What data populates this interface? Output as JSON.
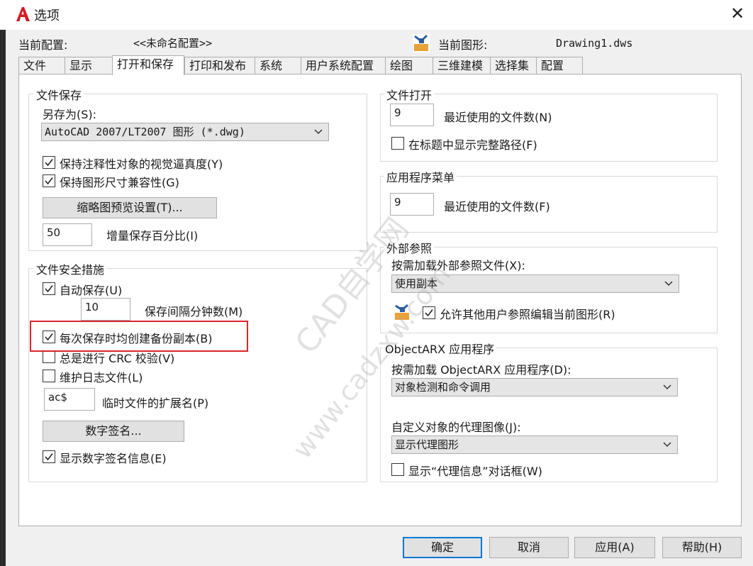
{
  "window": {
    "title": "选项",
    "close_glyph": "✕"
  },
  "header": {
    "profile_label": "当前配置:",
    "profile_value": "<<未命名配置>>",
    "drawing_label": "当前图形:",
    "drawing_value": "Drawing1.dws"
  },
  "tabs": [
    {
      "label": "文件"
    },
    {
      "label": "显示"
    },
    {
      "label": "打开和保存",
      "active": true
    },
    {
      "label": "打印和发布"
    },
    {
      "label": "系统"
    },
    {
      "label": "用户系统配置"
    },
    {
      "label": "绘图"
    },
    {
      "label": "三维建模"
    },
    {
      "label": "选择集"
    },
    {
      "label": "配置"
    }
  ],
  "file_save": {
    "title": "文件保存",
    "save_as_label": "另存为(S):",
    "save_as_value": "AutoCAD 2007/LT2007 图形 (*.dwg)",
    "cb_visual_fidelity": {
      "label": "保持注释性对象的视觉逼真度(Y)",
      "checked": true
    },
    "cb_drawing_size": {
      "label": "保持图形尺寸兼容性(G)",
      "checked": true
    },
    "thumbnail_button": "缩略图预览设置(T)...",
    "incremental_value": "50",
    "incremental_label": "增量保存百分比(I)"
  },
  "file_safety": {
    "title": "文件安全措施",
    "cb_autosave": {
      "label": "自动保存(U)",
      "checked": true
    },
    "interval_value": "10",
    "interval_label": "保存间隔分钟数(M)",
    "cb_backup": {
      "label": "每次保存时均创建备份副本(B)",
      "checked": true
    },
    "cb_crc": {
      "label": "总是进行 CRC 校验(V)",
      "checked": false
    },
    "cb_log": {
      "label": "维护日志文件(L)",
      "checked": false
    },
    "temp_ext_value": "ac$",
    "temp_ext_label": "临时文件的扩展名(P)",
    "digital_sig_button": "数字签名...",
    "cb_show_sig": {
      "label": "显示数字签名信息(E)",
      "checked": true
    }
  },
  "file_open": {
    "title": "文件打开",
    "recent_value": "9",
    "recent_label": "最近使用的文件数(N)",
    "cb_full_path": {
      "label": "在标题中显示完整路径(F)",
      "checked": false
    }
  },
  "app_menu": {
    "title": "应用程序菜单",
    "recent_value": "9",
    "recent_label": "最近使用的文件数(F)"
  },
  "xref": {
    "title": "外部参照",
    "load_label": "按需加载外部参照文件(X):",
    "load_value": "使用副本",
    "cb_allow_edit": {
      "label": "允许其他用户参照编辑当前图形(R)",
      "checked": true
    }
  },
  "objectarx": {
    "title": "ObjectARX 应用程序",
    "load_label": "按需加载 ObjectARX 应用程序(D):",
    "load_value": "对象检测和命令调用",
    "proxy_label": "自定义对象的代理图像(J):",
    "proxy_value": "显示代理图形",
    "cb_proxy_info": {
      "label": "显示“代理信息”对话框(W)",
      "checked": false
    }
  },
  "footer": {
    "ok": "确定",
    "cancel": "取消",
    "apply": "应用(A)",
    "help": "帮助(H)"
  },
  "watermark": {
    "line1": "CAD自学网",
    "line2": "www.cadzxw.com"
  },
  "colors": {
    "accent": "#0078d7",
    "highlight": "#d9262b",
    "logo": "#d71920"
  }
}
